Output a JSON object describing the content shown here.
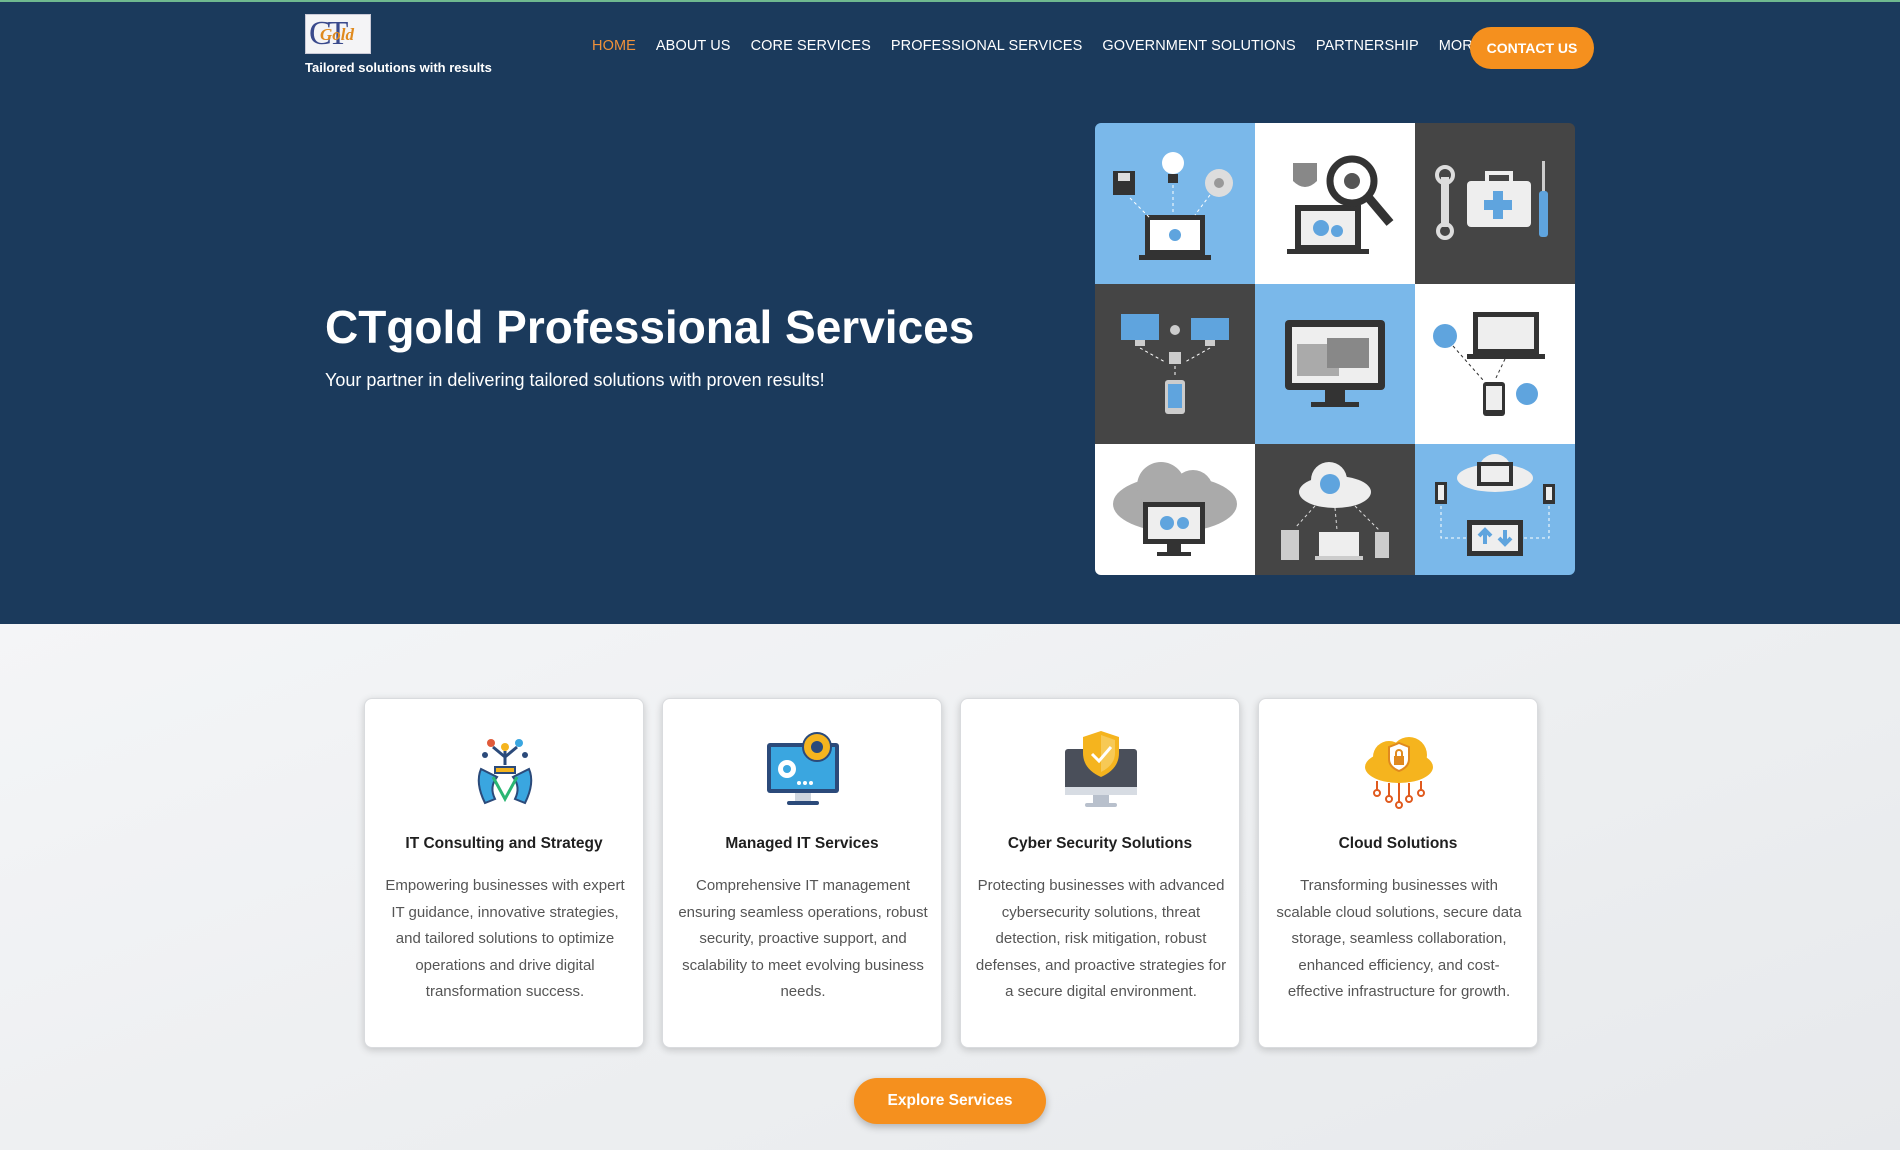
{
  "header": {
    "logo_text_ct": "CT",
    "logo_text_gold": "Gold",
    "tagline": "Tailored solutions with results",
    "nav": [
      {
        "label": "HOME",
        "active": true
      },
      {
        "label": "ABOUT US"
      },
      {
        "label": "CORE SERVICES"
      },
      {
        "label": "PROFESSIONAL SERVICES"
      },
      {
        "label": "GOVERNMENT SOLUTIONS"
      },
      {
        "label": "PARTNERSHIP"
      },
      {
        "label": "MORE"
      }
    ],
    "contact_label": "CONTACT US"
  },
  "hero": {
    "title": "CTgold Professional Services",
    "subtitle": "Your partner in delivering tailored solutions with proven results!"
  },
  "services": {
    "cards": [
      {
        "icon": "strategy-hands-icon",
        "title": "IT Consulting and Strategy",
        "description": "Empowering businesses with expert IT guidance, innovative strategies, and tailored solutions to optimize operations and drive digital transformation success."
      },
      {
        "icon": "monitor-gears-icon",
        "title": "Managed IT Services",
        "description": "Comprehensive IT management ensuring seamless operations, robust security, proactive support, and scalability to meet evolving business needs."
      },
      {
        "icon": "shield-monitor-icon",
        "title": "Cyber Security Solutions",
        "description": "Protecting businesses with advanced cybersecurity solutions, threat detection, risk mitigation, robust defenses, and proactive strategies for a secure digital environment."
      },
      {
        "icon": "cloud-lock-icon",
        "title": "Cloud Solutions",
        "description": "Transforming businesses with scalable cloud solutions, secure data storage, seamless collaboration, enhanced efficiency, and cost-effective infrastructure for growth."
      }
    ],
    "explore_label": "Explore Services"
  },
  "colors": {
    "hero_bg": "#1b3a5c",
    "accent": "#f5901e",
    "nav_active": "#f0913a",
    "tile_blue": "#7ab8ea",
    "tile_dark": "#454545"
  }
}
